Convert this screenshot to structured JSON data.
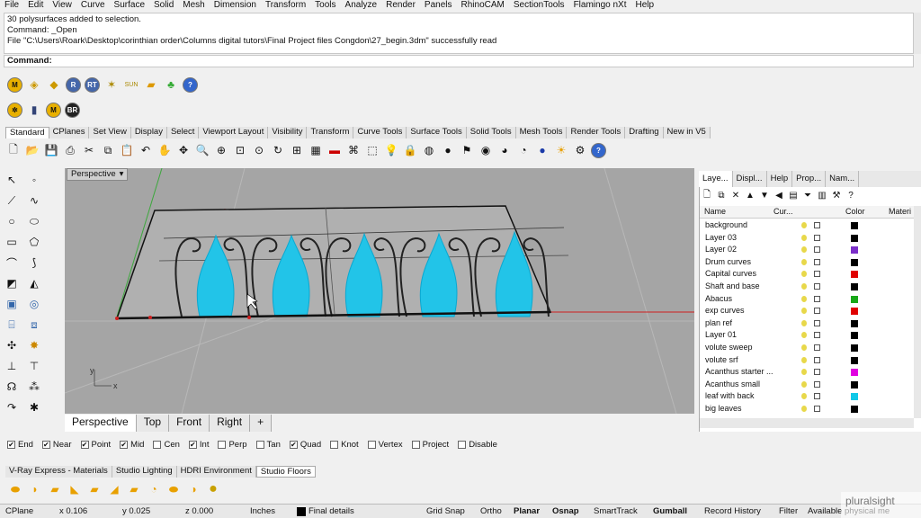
{
  "menu": [
    "File",
    "Edit",
    "View",
    "Curve",
    "Surface",
    "Solid",
    "Mesh",
    "Dimension",
    "Transform",
    "Tools",
    "Analyze",
    "Render",
    "Panels",
    "RhinoCAM",
    "SectionTools",
    "Flamingo nXt",
    "Help"
  ],
  "command_history": [
    "30 polysurfaces added to selection.",
    "Command: _Open",
    "File \"C:\\Users\\Roark\\Desktop\\corinthian order\\Columns digital tutors\\Final Project files Congdon\\27_begin.3dm\" successfully read"
  ],
  "command_prompt": "Command:",
  "plugin_row1": [
    "M",
    "",
    "",
    "R",
    "RT",
    "",
    "SUN",
    "",
    ""
  ],
  "plugin_row2": [
    "",
    "",
    "M",
    "BR"
  ],
  "toolbar_tabs": [
    "Standard",
    "CPlanes",
    "Set View",
    "Display",
    "Select",
    "Viewport Layout",
    "Visibility",
    "Transform",
    "Curve Tools",
    "Surface Tools",
    "Solid Tools",
    "Mesh Tools",
    "Render Tools",
    "Drafting",
    "New in V5"
  ],
  "viewport": {
    "label": "Perspective",
    "tabs": [
      "Perspective",
      "Top",
      "Front",
      "Right"
    ],
    "add_tab": "+",
    "axis_y": "y",
    "axis_x": "x"
  },
  "panel": {
    "tabs": [
      "Laye...",
      "Displ...",
      "Help",
      "Prop...",
      "Nam..."
    ],
    "headers": {
      "name": "Name",
      "current": "Cur...",
      "color": "Color",
      "material": "Materi"
    },
    "layers": [
      {
        "name": "background",
        "color": "#000000"
      },
      {
        "name": "Layer 03",
        "color": "#000000"
      },
      {
        "name": "Layer 02",
        "color": "#7b2fc9"
      },
      {
        "name": "Drum curves",
        "color": "#000000"
      },
      {
        "name": "Capital curves",
        "color": "#e00000"
      },
      {
        "name": "Shaft and base",
        "color": "#000000"
      },
      {
        "name": "Abacus",
        "color": "#18a818"
      },
      {
        "name": "exp curves",
        "color": "#e00000"
      },
      {
        "name": "plan ref",
        "color": "#000000"
      },
      {
        "name": "Layer 01",
        "color": "#000000"
      },
      {
        "name": "volute sweep",
        "color": "#000000"
      },
      {
        "name": "volute srf",
        "color": "#000000"
      },
      {
        "name": "Acanthus starter ...",
        "color": "#e000e0"
      },
      {
        "name": "Acanthus small",
        "color": "#000000"
      },
      {
        "name": "leaf with back",
        "color": "#10c8e8"
      },
      {
        "name": "big leaves",
        "color": "#000000"
      }
    ]
  },
  "osnaps": [
    {
      "label": "End",
      "checked": true
    },
    {
      "label": "Near",
      "checked": true
    },
    {
      "label": "Point",
      "checked": true
    },
    {
      "label": "Mid",
      "checked": true
    },
    {
      "label": "Cen",
      "checked": false
    },
    {
      "label": "Int",
      "checked": true
    },
    {
      "label": "Perp",
      "checked": false
    },
    {
      "label": "Tan",
      "checked": false
    },
    {
      "label": "Quad",
      "checked": true
    },
    {
      "label": "Knot",
      "checked": false
    },
    {
      "label": "Vertex",
      "checked": false
    },
    {
      "label": "Project",
      "checked": false
    },
    {
      "label": "Disable",
      "checked": false
    }
  ],
  "render_tabs": [
    "V-Ray Express - Materials",
    "Studio Lighting",
    "HDRI Environment",
    "Studio Floors"
  ],
  "status": {
    "cplane": "CPlane",
    "x": "x 0.106",
    "y": "y 0.025",
    "z": "z 0.000",
    "units": "Inches",
    "layer": "Final details",
    "grid_snap": "Grid Snap",
    "ortho": "Ortho",
    "planar": "Planar",
    "osnap": "Osnap",
    "smarttrack": "SmartTrack",
    "gumball": "Gumball",
    "record_history": "Record History",
    "filter": "Filter",
    "available": "Available physical me"
  },
  "watermark": {
    "brand": "pluralsight"
  },
  "colors": {
    "accent_cyan": "#22c4e8",
    "viewport_bg": "#a5a5a5"
  }
}
